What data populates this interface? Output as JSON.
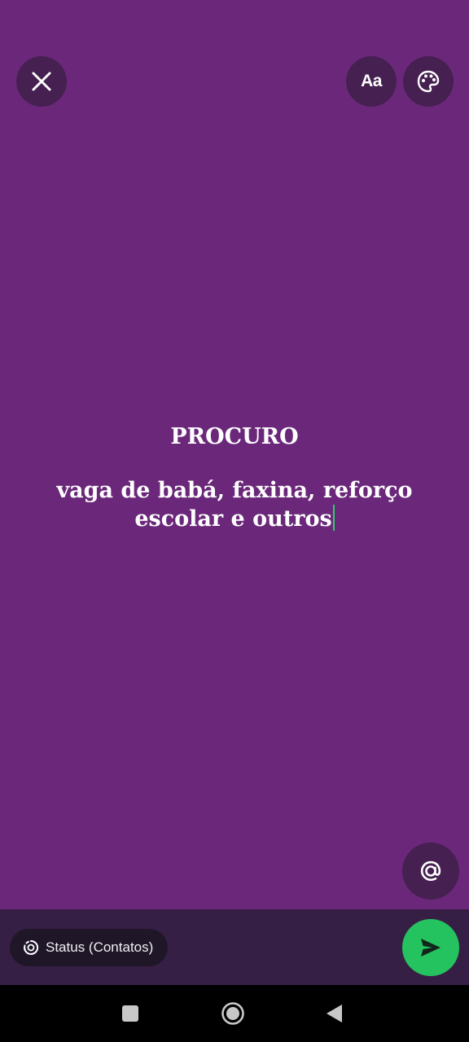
{
  "toolbar": {
    "close_icon": "close-icon",
    "font_button_label": "Aa",
    "color_icon": "palette-icon"
  },
  "editor": {
    "line1": "PROCURO",
    "line2": "vaga de babá, faxina, reforço",
    "line3": "escolar e outros",
    "cursor_color": "#25d366"
  },
  "mention_icon": "at-sign-icon",
  "bottom_bar": {
    "privacy_label": "Status (Contatos)",
    "privacy_icon": "status-icon",
    "send_icon": "send-icon"
  },
  "nav_bar": {
    "recents_icon": "square-icon",
    "home_icon": "circle-icon",
    "back_icon": "triangle-back-icon"
  },
  "colors": {
    "background": "#6b287a",
    "button_bg": "#452051",
    "send_button": "#25c35f",
    "bottom_bar": "#361f44"
  }
}
